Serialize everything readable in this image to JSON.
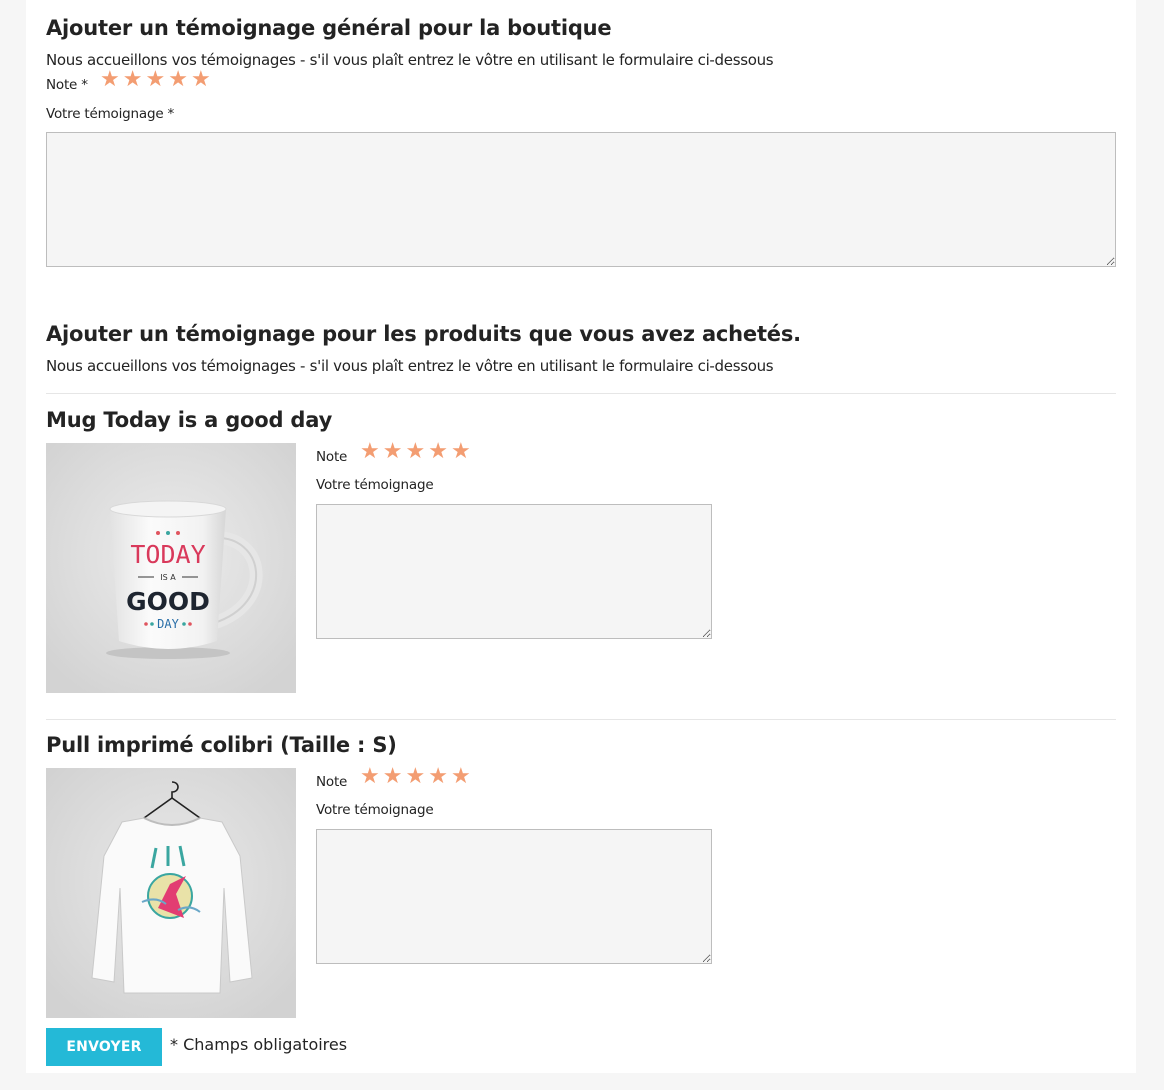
{
  "general": {
    "title": "Ajouter un témoignage général pour la boutique",
    "intro": "Nous accueillons vos témoignages - s'il vous plaît entrez le vôtre en utilisant le formulaire ci-dessous",
    "note_label": "Note *",
    "testimonial_label": "Votre témoignage *",
    "stars": [
      "★",
      "★",
      "★",
      "★",
      "★"
    ],
    "rating": 5
  },
  "products_section": {
    "title": "Ajouter un témoignage pour les produits que vous avez achetés.",
    "intro": "Nous accueillons vos témoignages - s'il vous plaît entrez le vôtre en utilisant le formulaire ci-dessous"
  },
  "products": [
    {
      "name": "Mug Today is a good day",
      "note_label": "Note",
      "testimonial_label": "Votre témoignage",
      "stars": [
        "★",
        "★",
        "★",
        "★",
        "★"
      ],
      "rating": 5,
      "image_text": [
        "TODAY",
        "IS A",
        "GOOD",
        "DAY"
      ]
    },
    {
      "name": "Pull imprimé colibri (Taille : S)",
      "note_label": "Note",
      "testimonial_label": "Votre témoignage",
      "stars": [
        "★",
        "★",
        "★",
        "★",
        "★"
      ],
      "rating": 5
    }
  ],
  "submit_label": "ENVOYER",
  "required_note": "* Champs obligatoires",
  "colors": {
    "star": "#f39d72",
    "button": "#24b9d7",
    "background": "#f6f6f6"
  }
}
